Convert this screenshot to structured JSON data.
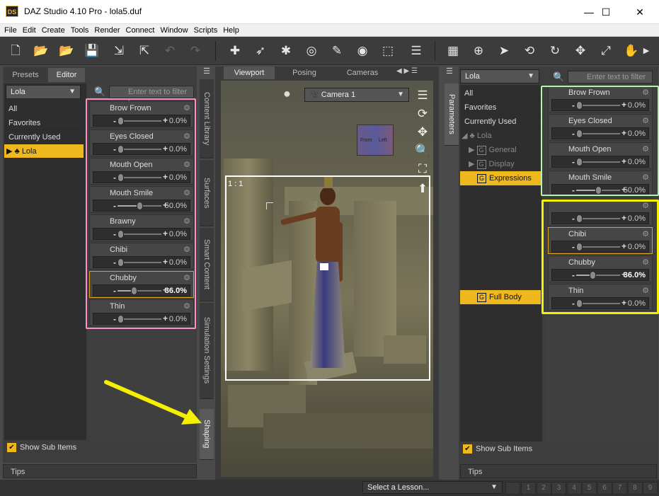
{
  "window": {
    "title": "DAZ Studio 4.10 Pro - lola5.duf",
    "logo": "DS",
    "minimize": "—",
    "maximize": "☐",
    "close": "✕"
  },
  "menu": [
    "File",
    "Edit",
    "Create",
    "Tools",
    "Render",
    "Connect",
    "Window",
    "Scripts",
    "Help"
  ],
  "toolbar_icons": [
    "new-file-icon",
    "open-file-icon",
    "open-recent-icon",
    "save-icon",
    "import-icon",
    "export-icon",
    "undo-icon",
    "redo-icon",
    "add-figure-icon",
    "active-pose-icon",
    "node-selection-icon",
    "universal-tool-icon",
    "joint-editor-icon",
    "spot-render-icon",
    "surface-selection-icon",
    "align-tool-icon",
    "grid-icon",
    "orbit-icon",
    "select-pointer-icon",
    "rotate-view-icon",
    "rotate-icon",
    "translate-icon",
    "scale-icon",
    "bend-tool-icon",
    "more-icon"
  ],
  "left": {
    "tabs": [
      "Presets",
      "Editor"
    ],
    "node_combo": "Lola",
    "list": [
      "All",
      "Favorites",
      "Currently Used",
      "Lola"
    ],
    "filter_placeholder": "Enter text to filter by...",
    "props": [
      {
        "name": "Brow Frown",
        "value": "0.0%",
        "pos": 0.0
      },
      {
        "name": "Eyes Closed",
        "value": "0.0%",
        "pos": 0.0
      },
      {
        "name": "Mouth Open",
        "value": "0.0%",
        "pos": 0.0
      },
      {
        "name": "Mouth Smile",
        "value": "50.0%",
        "pos": 0.5
      },
      {
        "name": "Brawny",
        "value": "0.0%",
        "pos": 0.0
      },
      {
        "name": "Chibi",
        "value": "0.0%",
        "pos": 0.0
      },
      {
        "name": "Chubby",
        "value": "36.0%",
        "pos": 0.36
      },
      {
        "name": "Thin",
        "value": "0.0%",
        "pos": 0.0
      }
    ],
    "show_sub": "Show Sub Items",
    "tips": "Tips",
    "side_tabs": [
      "Content Library",
      "Surfaces",
      "Smart Content",
      "Simulation Settings",
      "Shaping"
    ]
  },
  "viewport": {
    "tabs": [
      "Viewport",
      "Posing",
      "Cameras"
    ],
    "camera": "Camera 1",
    "ratio": "1 : 1",
    "cube": {
      "front": "Front",
      "left": "Left"
    }
  },
  "right": {
    "side_tab": "Parameters",
    "node_combo": "Lola",
    "filter_placeholder": "Enter text to filter by...",
    "list": [
      "All",
      "Favorites",
      "Currently Used"
    ],
    "tree": {
      "node": "Lola",
      "groups": [
        "General",
        "Display",
        "Expressions"
      ],
      "full": "Full Body"
    },
    "props": [
      {
        "name": "Brow Frown",
        "value": "0.0%",
        "pos": 0.0
      },
      {
        "name": "Eyes Closed",
        "value": "0.0%",
        "pos": 0.0
      },
      {
        "name": "Mouth Open",
        "value": "0.0%",
        "pos": 0.0
      },
      {
        "name": "Mouth Smile",
        "value": "50.0%",
        "pos": 0.5
      },
      {
        "name": "",
        "value": "0.0%",
        "pos": 0.0
      },
      {
        "name": "Chibi",
        "value": "0.0%",
        "pos": 0.0
      },
      {
        "name": "Chubby",
        "value": "36.0%",
        "pos": 0.36
      },
      {
        "name": "Thin",
        "value": "0.0%",
        "pos": 0.0
      }
    ],
    "show_sub": "Show Sub Items",
    "tips": "Tips"
  },
  "lesson": {
    "placeholder": "Select a Lesson...",
    "steps": [
      "1",
      "2",
      "3",
      "4",
      "5",
      "6",
      "7",
      "8",
      "9"
    ]
  },
  "colors": {
    "pink_outline": "#ff8fc8",
    "green_outline": "#b8f0b0",
    "yellow_outline": "#f5f000",
    "arrow": "#f5f000",
    "accent": "#f0b81f"
  }
}
